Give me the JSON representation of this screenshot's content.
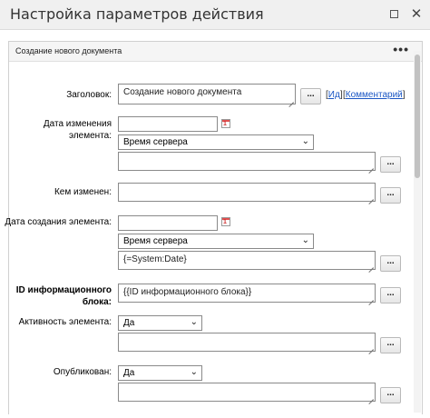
{
  "window": {
    "title": "Настройка параметров действия",
    "restore_icon": "restore-icon",
    "close_symbol": "✕"
  },
  "panel": {
    "title": "Создание нового документа",
    "menu_symbol": "•••"
  },
  "fields": {
    "title_label": "Заголовок:",
    "title_value": "Создание нового документа",
    "link_id": "Ид",
    "link_comment": "Комментарий",
    "modified_date_label": "Дата изменения элемента:",
    "modified_date_select": "Время сервера",
    "modified_by_label": "Кем изменен:",
    "created_date_label": "Дата создания элемента:",
    "created_date_select": "Время сервера",
    "created_date_value": "{=System:Date}",
    "block_id_label": "ID информационного блока:",
    "block_id_value": "{{ID информационного блока}}",
    "active_label": "Активность элемента:",
    "active_select": "Да",
    "published_label": "Опубликован:",
    "published_select": "Да"
  },
  "buttons": {
    "more": "...",
    "calendar_num": "1"
  }
}
